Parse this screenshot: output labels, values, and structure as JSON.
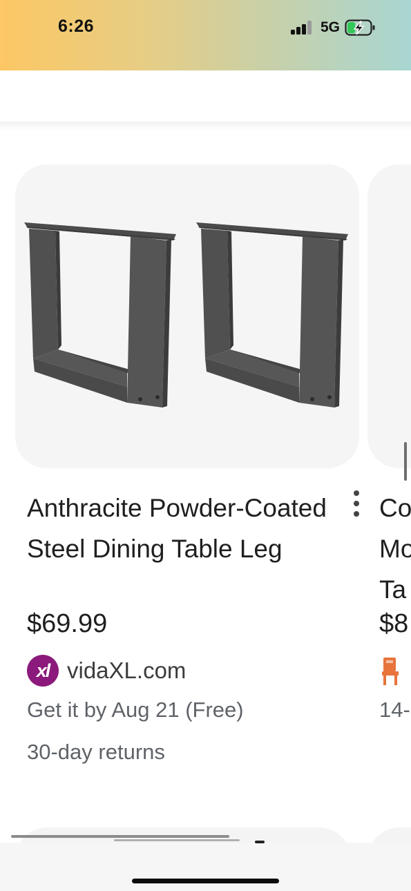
{
  "status_bar": {
    "time": "6:26",
    "network": "5G",
    "signal_bars_active": 3,
    "signal_bars_total": 4,
    "battery_state": "charging",
    "battery_level": 0.35,
    "icons": [
      "signal-icon",
      "battery-charging-icon"
    ]
  },
  "products": [
    {
      "title": "Anthracite Powder-Coated Steel Dining Table Leg",
      "price": "$69.99",
      "merchant": "vidaXL.com",
      "merchant_logo_text": "xl",
      "delivery": "Get it by Aug 21 (Free)",
      "returns": "30-day returns",
      "image": "two-steel-table-legs",
      "more_options_icon": "more-vert-icon"
    }
  ],
  "next_product_partial": {
    "title": "Co\nMo\nTa",
    "price": "$8",
    "merchant_icon": "chair-icon",
    "delivery": "14-"
  },
  "colors": {
    "status_gradient": [
      "#fcc764",
      "#a8d6d2"
    ],
    "image_bg": "#f5f5f5",
    "merchant_logo": "#8b1a7c",
    "chair_icon": "#e8743b",
    "battery_fill": "#34c759"
  }
}
